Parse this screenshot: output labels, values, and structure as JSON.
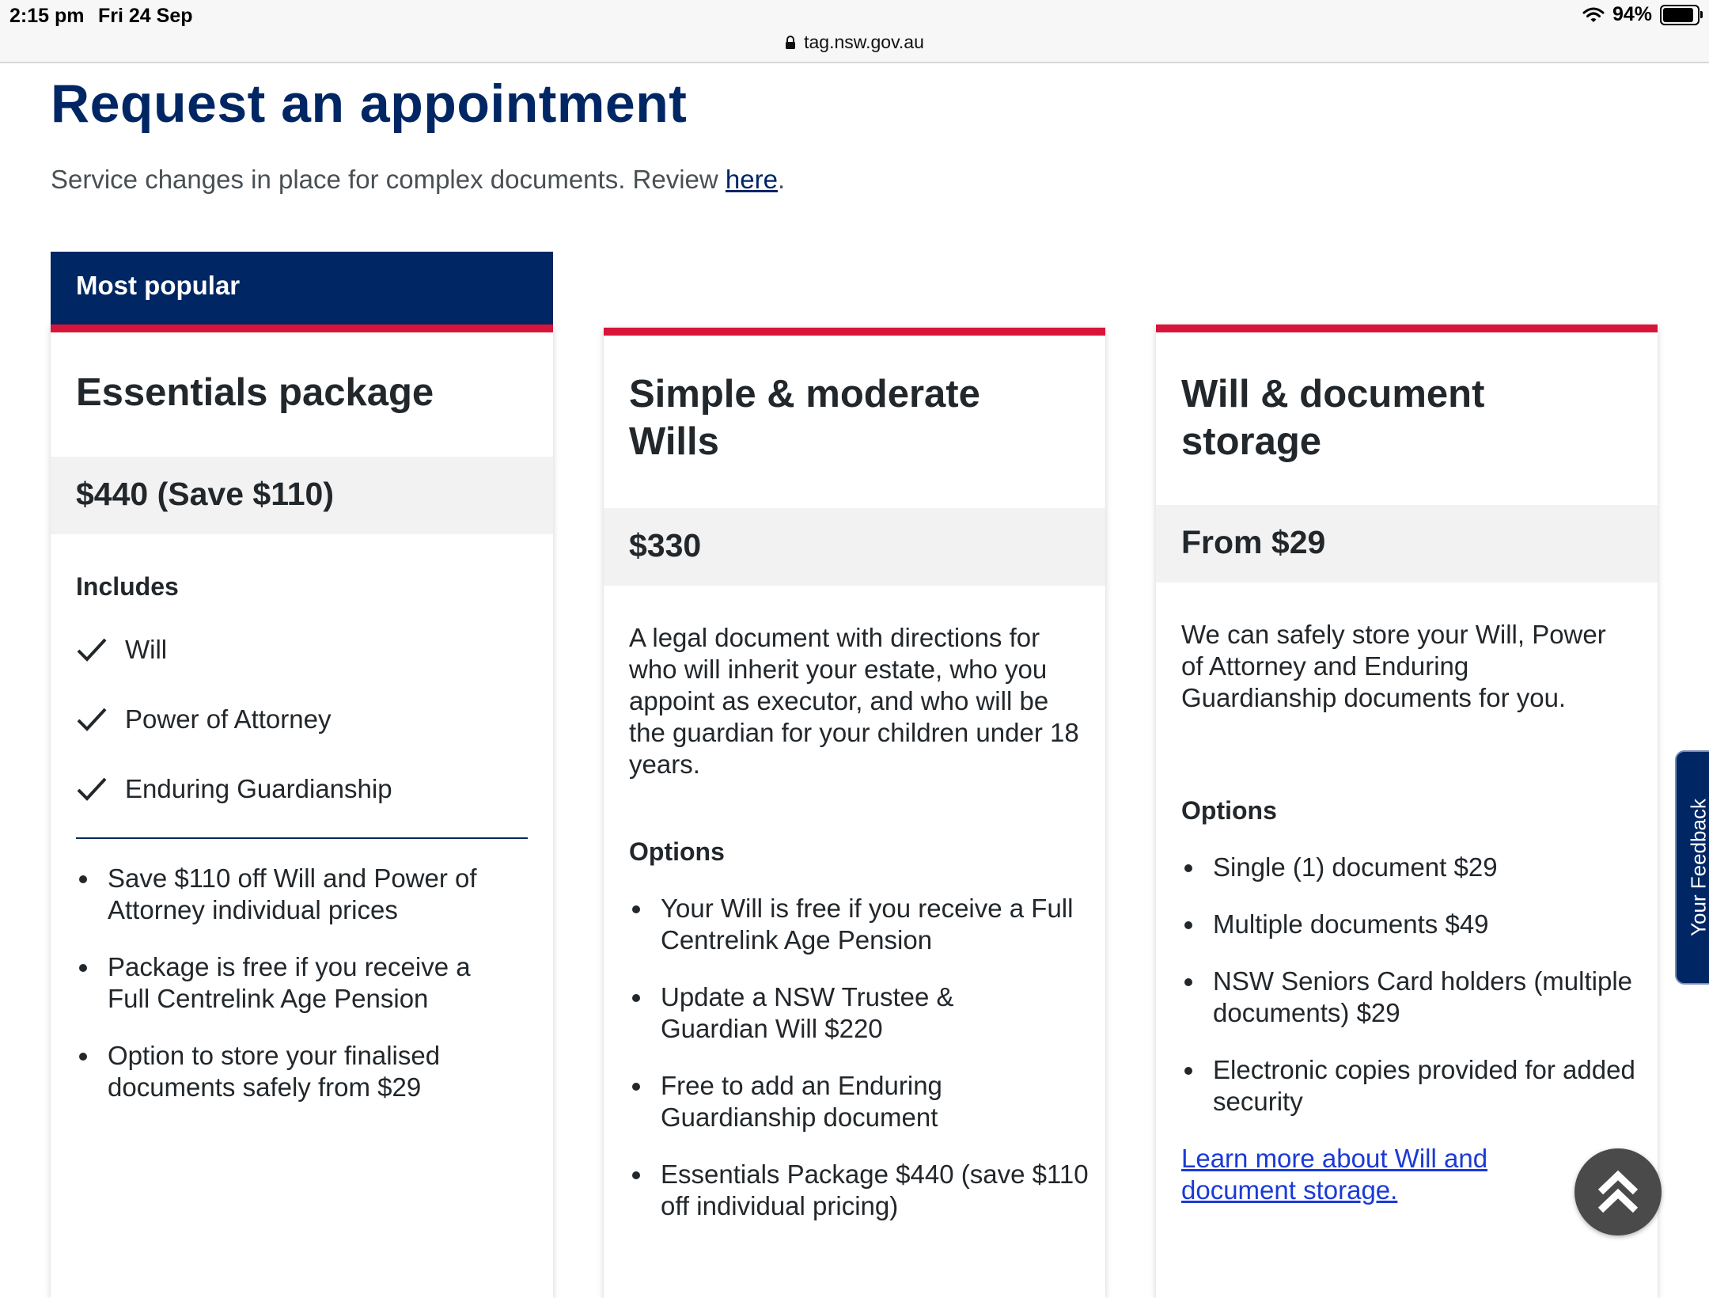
{
  "status_bar": {
    "time": "2:15 pm",
    "date": "Fri 24 Sep",
    "url": "tag.nsw.gov.au",
    "battery": "94%",
    "battery_level": 0.94
  },
  "page": {
    "title": "Request an appointment",
    "notice_text": "Service changes in place for complex documents. Review ",
    "notice_link": "here",
    "notice_end": "."
  },
  "cards": {
    "essentials": {
      "badge": "Most popular",
      "title": "Essentials package",
      "price": "$440 (Save $110)",
      "includes_heading": "Includes",
      "includes": [
        "Will",
        "Power of Attorney",
        "Enduring Guardianship"
      ],
      "bullets": [
        "Save $110 off Will and Power of Attorney individual prices",
        "Package is free if you receive a Full Centrelink Age Pension",
        "Option to store your finalised documents safely from $29"
      ]
    },
    "wills": {
      "title_line1": "Simple & moderate",
      "title_line2": "Wills",
      "price": "$330",
      "description": "A legal document with directions for who will inherit your estate, who you appoint as executor, and who will be the guardian for your children under 18 years.",
      "options_heading": "Options",
      "options": [
        "Your Will is free if you receive a Full Centrelink Age Pension",
        "Update a NSW Trustee & Guardian Will $220",
        "Free to add an Enduring Guardianship document",
        "Essentials Package $440 (save $110 off individual pricing)"
      ]
    },
    "storage": {
      "title_line1": "Will & document",
      "title_line2": "storage",
      "price": "From $29",
      "description": "We can safely store your Will, Power of Attorney and Enduring Guardianship documents for you.",
      "options_heading": "Options",
      "options": [
        "Single (1) document $29",
        "Multiple documents $49",
        "NSW Seniors Card holders (multiple documents) $29",
        "Electronic copies provided for added security"
      ],
      "learn_more": "Learn more about Will and document storage."
    }
  },
  "feedback_tab": "Your Feedback",
  "colors": {
    "brand_navy": "#002664",
    "accent_red": "#d7153a",
    "price_bg": "#f2f2f3",
    "link_blue": "#1a3ad6"
  }
}
